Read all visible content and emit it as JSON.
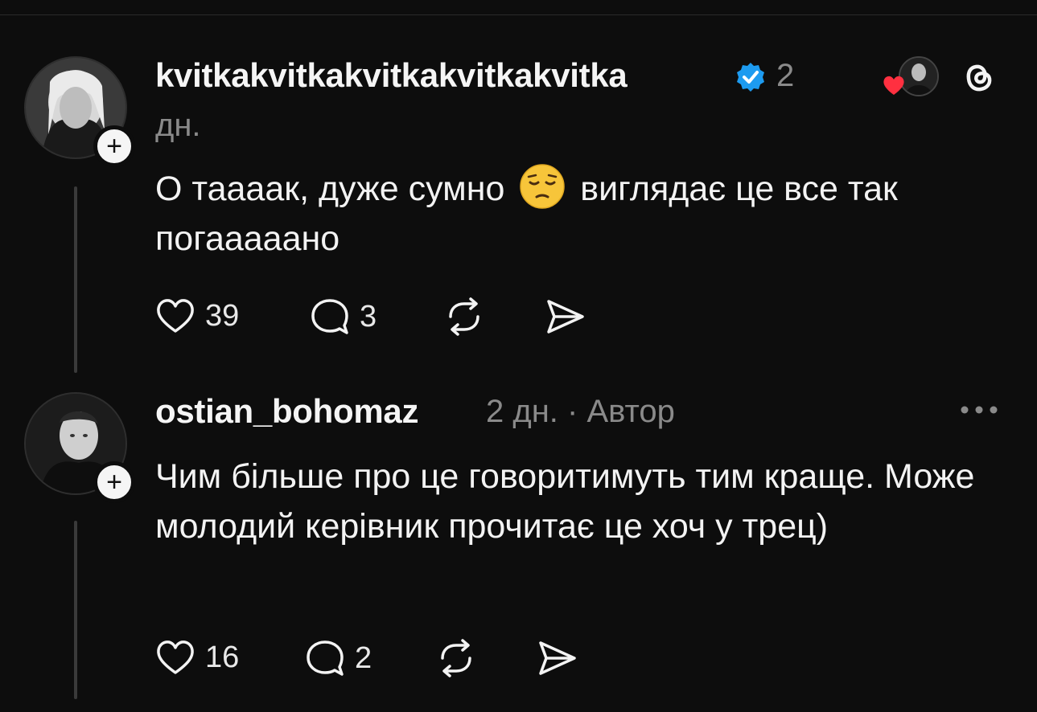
{
  "posts": [
    {
      "username": "kvitkakvitkakvitkakvitkakvitka",
      "time_line1": "2",
      "time_line2": "дн.",
      "verified": true,
      "text_part1": "О таааак, дуже сумно ",
      "emoji": "pensive-face",
      "text_part2": " виглядає це все так погааааано",
      "likes": "39",
      "replies": "3",
      "liked_by_author": true
    },
    {
      "username": "ostian_bohomaz",
      "meta": "2 дн. · Автор",
      "text": "Чим більше про це говоритимуть тим краще. Може молодий керівник прочитає це хоч у трец)",
      "likes": "16",
      "replies": "2"
    }
  ],
  "colors": {
    "background": "#0d0d0d",
    "text": "#f3f3f3",
    "muted": "#8a8a8a",
    "verified": "#1d9bf0",
    "heart": "#ff3040"
  },
  "icons": [
    "heart-icon",
    "reply-icon",
    "repost-icon",
    "share-icon",
    "threads-logo-icon",
    "more-icon",
    "verified-icon",
    "plus-icon"
  ]
}
